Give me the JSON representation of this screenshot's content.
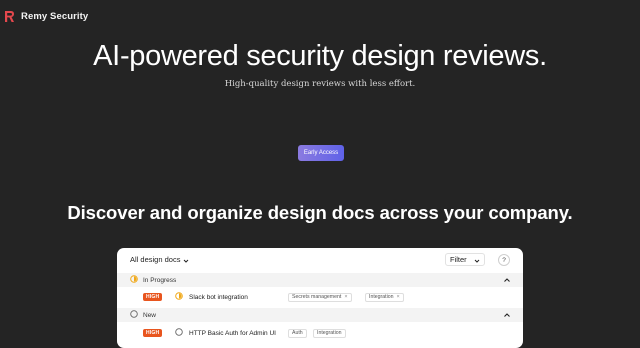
{
  "brand": {
    "name": "Remy Security",
    "logo_icon": "remy-logo-icon",
    "logo_color": "#e5484d"
  },
  "hero": {
    "title": "AI-powered security design reviews.",
    "subtitle": "High-quality design reviews with less effort.",
    "cta_label": "Early Access"
  },
  "section": {
    "title": "Discover and organize design docs across your company."
  },
  "panel": {
    "dropdown_label": "All design docs",
    "filter_label": "Filter",
    "help_label": "?",
    "groups": [
      {
        "label": "In Progress",
        "icon": "in-progress-icon",
        "items": [
          {
            "priority": "HIGH",
            "name": "Slack bot integration",
            "icon": "in-progress-icon",
            "tags": [
              "Secrets management",
              "Integration"
            ]
          }
        ]
      },
      {
        "label": "New",
        "icon": "circle-icon",
        "items": [
          {
            "priority": "HIGH",
            "name": "HTTP Basic Auth for Admin UI",
            "icon": "circle-icon",
            "tags": [
              "Auth",
              "Integration"
            ]
          }
        ]
      }
    ]
  },
  "colors": {
    "background": "#242424",
    "cta_start": "#8b7be0",
    "cta_end": "#5f62e8",
    "badge_high": "#e8551e",
    "in_progress": "#f0a818"
  }
}
